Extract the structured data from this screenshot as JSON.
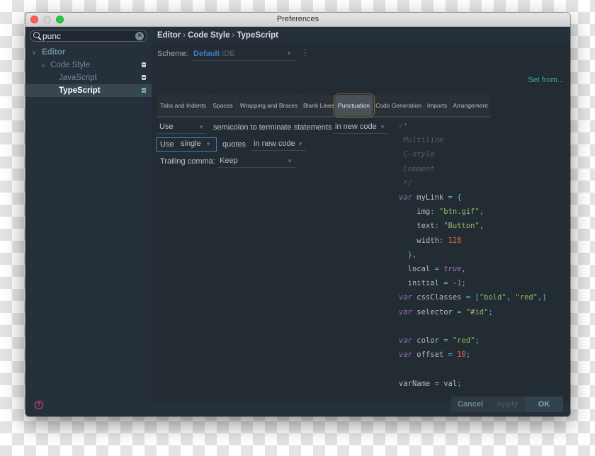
{
  "window": {
    "title": "Preferences"
  },
  "sidebar": {
    "search": {
      "value": "punc",
      "placeholder": ""
    },
    "items": [
      {
        "label": "Editor",
        "level": 0,
        "expanded": true
      },
      {
        "label": "Code Style",
        "level": 1,
        "expanded": true
      },
      {
        "label": "JavaScript",
        "level": 2
      },
      {
        "label": "TypeScript",
        "level": 2,
        "selected": true
      }
    ]
  },
  "breadcrumb": [
    "Editor",
    "Code Style",
    "TypeScript"
  ],
  "breadcrumb_sep": "›",
  "scheme": {
    "label": "Scheme:",
    "name": "Default",
    "scope": "IDE"
  },
  "set_from": "Set from...",
  "tabs": [
    {
      "label": "Tabs and Indents"
    },
    {
      "label": "Spaces"
    },
    {
      "label": "Wrapping and Braces"
    },
    {
      "label": "Blank Lines"
    },
    {
      "label": "Punctuation",
      "active": true
    },
    {
      "label": "Code Generation"
    },
    {
      "label": "Imports"
    },
    {
      "label": "Arrangement"
    }
  ],
  "punctuation": {
    "semicolon": {
      "use": "Use",
      "text": "semicolon to terminate statements",
      "scope": "in new code"
    },
    "quotes": {
      "prefix": "Use",
      "value": "single",
      "text": "quotes",
      "scope": "in new code"
    },
    "trailing_comma": {
      "label": "Trailing comma:",
      "value": "Keep"
    }
  },
  "code_preview": [
    [
      [
        "c-cm",
        "/*"
      ]
    ],
    [
      [
        "c-cm",
        " Multiline"
      ]
    ],
    [
      [
        "c-cm",
        " C-style"
      ]
    ],
    [
      [
        "c-cm",
        " Comment"
      ]
    ],
    [
      [
        "c-cm",
        " */"
      ]
    ],
    [
      [
        "c-kw",
        "var"
      ],
      [
        "c-id",
        " myLink "
      ],
      [
        "c-op",
        "= {"
      ]
    ],
    [
      [
        "c-id",
        "    img"
      ],
      [
        "c-op",
        ": "
      ],
      [
        "c-str",
        "\"btn.gif\""
      ],
      [
        "c-op",
        ","
      ]
    ],
    [
      [
        "c-id",
        "    text"
      ],
      [
        "c-op",
        ": "
      ],
      [
        "c-str",
        "\"Button\""
      ],
      [
        "c-op",
        ","
      ]
    ],
    [
      [
        "c-id",
        "    width"
      ],
      [
        "c-op",
        ": "
      ],
      [
        "c-num",
        "128"
      ]
    ],
    [
      [
        "c-op",
        "  },"
      ]
    ],
    [
      [
        "c-id",
        "  local "
      ],
      [
        "c-op",
        "= "
      ],
      [
        "c-kw",
        "true"
      ],
      [
        "c-op",
        ","
      ]
    ],
    [
      [
        "c-id",
        "  initial "
      ],
      [
        "c-op",
        "= -"
      ],
      [
        "c-num",
        "1"
      ],
      [
        "c-op",
        ";"
      ]
    ],
    [
      [
        "c-kw",
        "var"
      ],
      [
        "c-id",
        " cssClasses "
      ],
      [
        "c-op",
        "= ["
      ],
      [
        "c-str",
        "\"bold\""
      ],
      [
        "c-op",
        ", "
      ],
      [
        "c-str",
        "\"red\""
      ],
      [
        "c-op",
        ",]"
      ]
    ],
    [
      [
        "c-kw",
        "var"
      ],
      [
        "c-id",
        " selector "
      ],
      [
        "c-op",
        "= "
      ],
      [
        "c-str",
        "\"#id\""
      ],
      [
        "c-op",
        ";"
      ]
    ],
    [],
    [
      [
        "c-kw",
        "var"
      ],
      [
        "c-id",
        " color "
      ],
      [
        "c-op",
        "= "
      ],
      [
        "c-str",
        "\"red\""
      ],
      [
        "c-op",
        ";"
      ]
    ],
    [
      [
        "c-kw",
        "var"
      ],
      [
        "c-id",
        " offset "
      ],
      [
        "c-op",
        "= "
      ],
      [
        "c-num",
        "10"
      ],
      [
        "c-op",
        ";"
      ]
    ],
    [],
    [
      [
        "c-id",
        "varName "
      ],
      [
        "c-op",
        "= "
      ],
      [
        "c-id",
        "val"
      ],
      [
        "c-op",
        ";"
      ]
    ]
  ],
  "footer": {
    "help_icon": "question-circle-icon",
    "cancel": "Cancel",
    "apply": "Apply",
    "ok": "OK"
  },
  "colors": {
    "accent_blue": "#3d7fc4",
    "link_teal": "#3ea8a4",
    "help_red": "#e2446a",
    "active_tab_outline": "#8a6b2e"
  }
}
